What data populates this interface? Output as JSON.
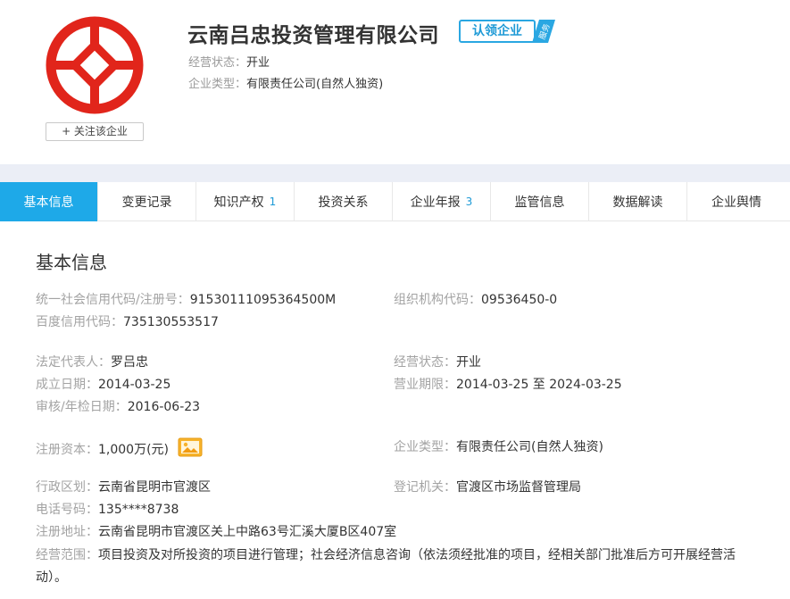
{
  "company": {
    "name": "云南吕忠投资管理有限公司",
    "claim_label": "认领企业",
    "claim_tag": "服务",
    "follow_button": "+ 关注该企业",
    "status_label": "经营状态：",
    "status_value": "开业",
    "type_label": "企业类型：",
    "type_value": "有限责任公司(自然人独资)",
    "logo_color": "#e1251b"
  },
  "tabs": [
    {
      "label": "基本信息",
      "count": "",
      "active": true
    },
    {
      "label": "变更记录",
      "count": ""
    },
    {
      "label": "知识产权",
      "count": "1"
    },
    {
      "label": "投资关系",
      "count": ""
    },
    {
      "label": "企业年报",
      "count": "3"
    },
    {
      "label": "监管信息",
      "count": ""
    },
    {
      "label": "数据解读",
      "count": ""
    },
    {
      "label": "企业舆情",
      "count": ""
    }
  ],
  "basic": {
    "title": "基本信息",
    "credit_code_label": "统一社会信用代码/注册号：",
    "credit_code_value": "91530111095364500M",
    "org_code_label": "组织机构代码：",
    "org_code_value": "09536450-0",
    "baidu_code_label": "百度信用代码：",
    "baidu_code_value": "735130553517",
    "legal_rep_label": "法定代表人：",
    "legal_rep_value": "罗吕忠",
    "status_label": "经营状态：",
    "status_value": "开业",
    "founded_label": "成立日期：",
    "founded_value": "2014-03-25",
    "term_label": "营业期限：",
    "term_value": "2014-03-25 至 2024-03-25",
    "audit_label": "审核/年检日期：",
    "audit_value": "2016-06-23",
    "capital_label": "注册资本：",
    "capital_value": "1,000万(元)",
    "type_label": "企业类型：",
    "type_value": "有限责任公司(自然人独资)",
    "region_label": "行政区划：",
    "region_value": "云南省昆明市官渡区",
    "authority_label": "登记机关：",
    "authority_value": "官渡区市场监督管理局",
    "phone_label": "电话号码：",
    "phone_value": "135****8738",
    "address_label": "注册地址：",
    "address_value": "云南省昆明市官渡区关上中路63号汇溪大厦B区407室",
    "scope_label": "经营范围：",
    "scope_value": "项目投资及对所投资的项目进行管理；社会经济信息咨询（依法须经批准的项目，经相关部门批准后方可开展经营活动）。"
  }
}
